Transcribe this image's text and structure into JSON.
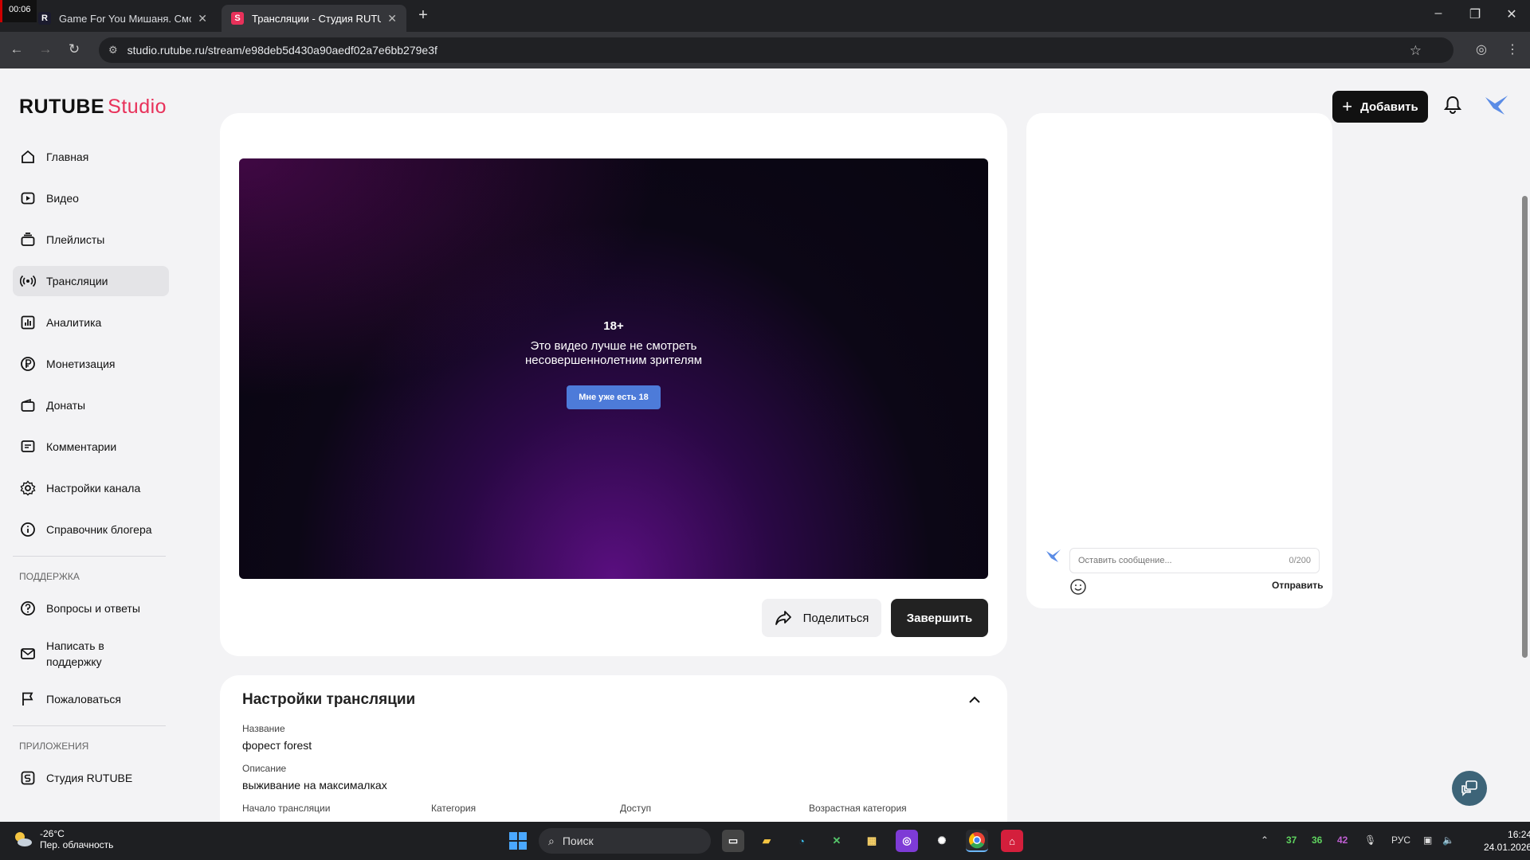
{
  "browser": {
    "clock_badge": "00:06",
    "tabs": [
      {
        "title": "Game For You Мишаня. Смотр",
        "favicon": "R",
        "active": false
      },
      {
        "title": "Трансляции - Студия RUTUBE",
        "favicon": "S",
        "active": true
      }
    ],
    "url": "studio.rutube.ru/stream/e98deb5d430a90aedf02a7e6bb279e3f"
  },
  "header": {
    "logo_main": "RUTUBE",
    "logo_studio": "Studio",
    "add_button": "Добавить",
    "brand_color": "#e8315a"
  },
  "sidebar": {
    "items": [
      {
        "label": "Главная",
        "icon": "home-icon"
      },
      {
        "label": "Видео",
        "icon": "video-icon"
      },
      {
        "label": "Плейлисты",
        "icon": "playlist-icon"
      },
      {
        "label": "Трансляции",
        "icon": "broadcast-icon",
        "active": true
      },
      {
        "label": "Аналитика",
        "icon": "chart-icon"
      },
      {
        "label": "Монетизация",
        "icon": "ruble-icon"
      },
      {
        "label": "Донаты",
        "icon": "wallet-icon"
      },
      {
        "label": "Комментарии",
        "icon": "comment-icon"
      },
      {
        "label": "Настройки канала",
        "icon": "gear-icon"
      },
      {
        "label": "Справочник блогера",
        "icon": "info-icon"
      }
    ],
    "support_label": "ПОДДЕРЖКА",
    "support_items": [
      {
        "label": "Вопросы и ответы",
        "icon": "question-icon"
      },
      {
        "label": "Написать в поддержку",
        "icon": "mail-icon"
      },
      {
        "label": "Пожаловаться",
        "icon": "flag-icon"
      }
    ],
    "apps_label": "ПРИЛОЖЕНИЯ",
    "apps_items": [
      {
        "label": "Студия RUTUBE",
        "icon": "studio-app-icon"
      }
    ]
  },
  "player": {
    "age_badge": "18+",
    "warning_line1": "Это видео лучше не смотреть",
    "warning_line2": "несовершеннолетним зрителям",
    "confirm_button": "Мне уже есть 18"
  },
  "actions": {
    "share": "Поделиться",
    "end": "Завершить"
  },
  "chat": {
    "placeholder": "Оставить сообщение...",
    "counter": "0/200",
    "send": "Отправить"
  },
  "settings": {
    "title": "Настройки трансляции",
    "name_label": "Название",
    "name_value": "форест forest",
    "desc_label": "Описание",
    "desc_value": "выживание на максималках",
    "start_label": "Начало трансляции",
    "category_label": "Категория",
    "access_label": "Доступ",
    "age_label": "Возрастная категория"
  },
  "taskbar": {
    "temp": "-26°C",
    "weather": "Пер. облачность",
    "search": "Поиск",
    "tray_nums": [
      "37",
      "36",
      "42"
    ],
    "lang": "РУС",
    "time": "16:24",
    "date": "24.01.2026"
  }
}
